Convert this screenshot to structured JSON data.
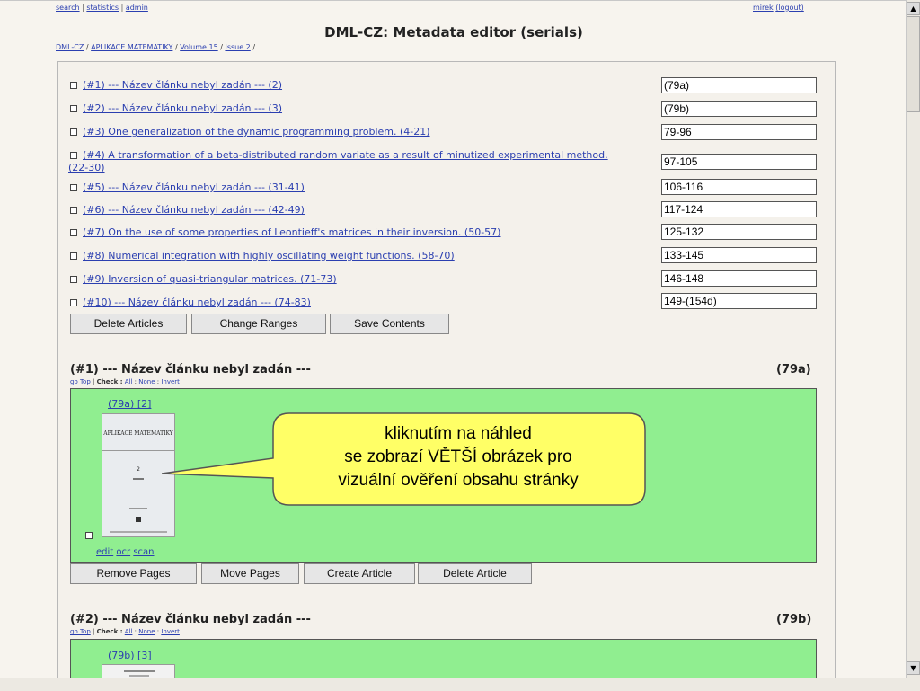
{
  "top": {
    "links": [
      "search",
      "statistics",
      "admin"
    ],
    "user": "mirek",
    "logout": "(logout)"
  },
  "title": "DML-CZ: Metadata editor (serials)",
  "breadcrumb": [
    "DML-CZ",
    "APLIKACE MATEMATIKY",
    "Volume 15",
    "Issue 2"
  ],
  "articles": [
    {
      "label": "(#1) --- Název článku nebyl zadán --- (2)",
      "range": "(79a)"
    },
    {
      "label": "(#2) --- Název článku nebyl zadán --- (3)",
      "range": "(79b)"
    },
    {
      "label": "(#3) One generalization of the dynamic programming problem. (4-21)",
      "range": "79-96"
    },
    {
      "label": "(#4) A transformation of a beta-distributed random variate as a result of minutized experimental method.",
      "label2": "(22-30)",
      "range": "97-105"
    },
    {
      "label": "(#5) --- Název článku nebyl zadán --- (31-41)",
      "range": "106-116"
    },
    {
      "label": "(#6) --- Název článku nebyl zadán --- (42-49)",
      "range": "117-124"
    },
    {
      "label": "(#7) On the use of some properties of Leontieff's matrices in their inversion. (50-57)",
      "range": "125-132"
    },
    {
      "label": "(#8) Numerical integration with highly oscillating weight functions. (58-70)",
      "range": "133-145"
    },
    {
      "label": "(#9) Inversion of quasi-triangular matrices. (71-73)",
      "range": "146-148"
    },
    {
      "label": "(#10) --- Název článku nebyl zadán --- (74-83)",
      "range": "149-(154d)"
    }
  ],
  "buttons": {
    "delete_articles": "Delete Articles",
    "change_ranges": "Change Ranges",
    "save_contents": "Save Contents"
  },
  "section1": {
    "title": "(#1) --- Název článku nebyl zadán ---",
    "range": "(79a)",
    "go_top": "go Top",
    "check_label": "Check :",
    "check_all": "All",
    "check_none": "None",
    "check_invert": "Invert",
    "page_link": "(79a) [2]",
    "thumb_title": "APLIKACE MATEMATIKY",
    "thumb_num": "2",
    "edit": "edit",
    "ocr": "ocr",
    "scan": "scan",
    "buttons": {
      "remove": "Remove Pages",
      "move": "Move Pages",
      "create": "Create Article",
      "delete": "Delete Article"
    }
  },
  "callout": {
    "line1": "kliknutím na náhled",
    "line2": "se zobrazí VĚTŠÍ obrázek pro",
    "line3": "vizuální ověření obsahu stránky",
    "color": "#ffff66"
  },
  "section2": {
    "title": "(#2) --- Název článku nebyl zadán ---",
    "range": "(79b)",
    "go_top": "go Top",
    "check_label": "Check :",
    "check_all": "All",
    "check_none": "None",
    "check_invert": "Invert",
    "page_link": "(79b) [3]"
  },
  "colors": {
    "page_bg": "#f7f4ee",
    "green": "#90ee90",
    "link": "#2b3fb0"
  }
}
